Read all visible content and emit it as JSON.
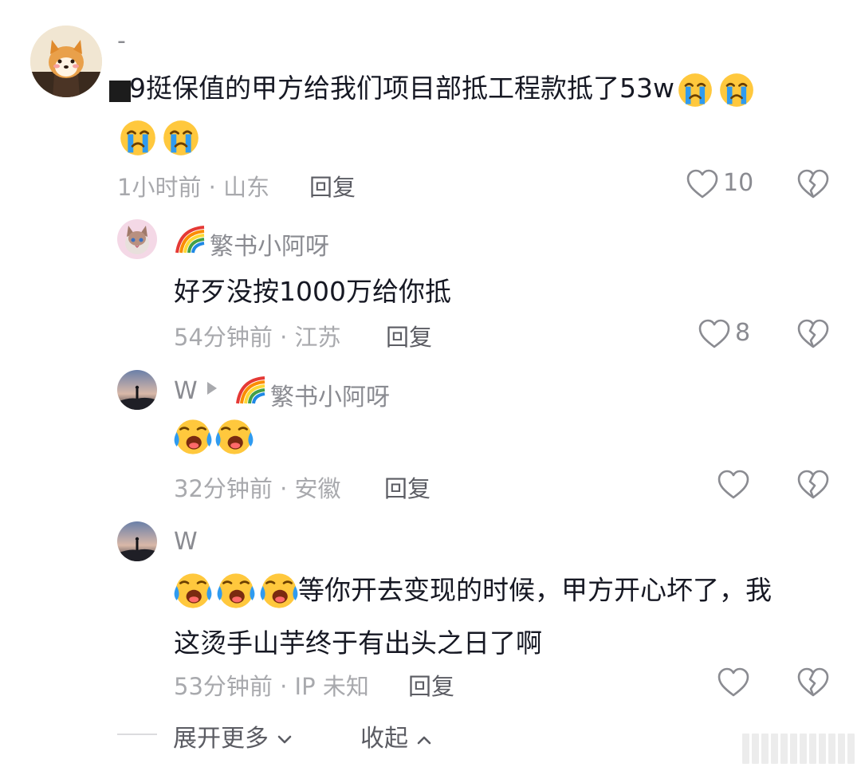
{
  "top_comment": {
    "username": "-",
    "text": "9挺保值的甲方给我们项目部抵工程款抵了53w",
    "emojis": [
      "cry-emoji",
      "cry-emoji",
      "cry-emoji",
      "cry-emoji"
    ],
    "time_location": "1小时前 · 山东",
    "reply_label": "回复",
    "likes": "10"
  },
  "replies": [
    {
      "username": "繁书小阿呀",
      "text": "好歹没按1000万给你抵",
      "time_location": "54分钟前 · 江苏",
      "reply_label": "回复",
      "likes": "8"
    },
    {
      "username": "W",
      "reply_to": "繁书小阿呀",
      "time_location": "32分钟前 · 安徽",
      "reply_label": "回复",
      "likes": ""
    },
    {
      "username": "W",
      "text_line1": "等你开去变现的时候，甲方开心坏了，我",
      "text_line2": "这烫手山芋终于有出头之日了啊",
      "time_location": "53分钟前 · IP 未知",
      "reply_label": "回复",
      "likes": ""
    }
  ],
  "footer": {
    "expand_label": "展开更多",
    "collapse_label": "收起"
  },
  "colors": {
    "primary_text": "#161823",
    "secondary_text": "#8a8b91",
    "meta_text": "#a8a9ad"
  }
}
